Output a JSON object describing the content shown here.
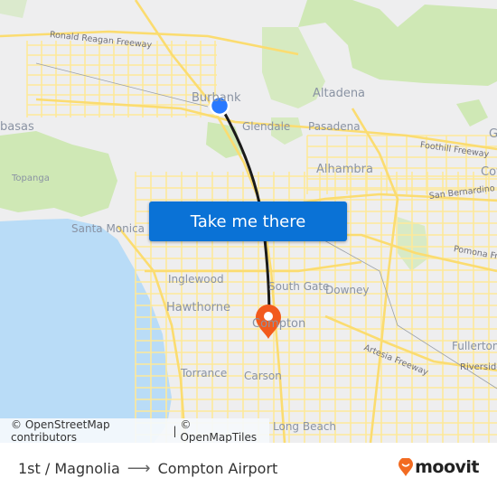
{
  "map": {
    "colors": {
      "land": "#eeeeef",
      "water": "#b9dcf7",
      "park": "#cfe8b5",
      "road": "#fde99a",
      "route": "#1a1a1a",
      "origin": "#2979ff",
      "destination": "#f25a1d"
    },
    "places": [
      {
        "id": "burbank",
        "label": "Burbank"
      },
      {
        "id": "altadena",
        "label": "Altadena"
      },
      {
        "id": "glendale",
        "label": "Glendale"
      },
      {
        "id": "pasadena",
        "label": "Pasadena"
      },
      {
        "id": "calabasas",
        "label": "basas"
      },
      {
        "id": "alhambra",
        "label": "Alhambra"
      },
      {
        "id": "topanga",
        "label": "Topanga"
      },
      {
        "id": "santa-monica",
        "label": "Santa Monica"
      },
      {
        "id": "inglewood",
        "label": "Inglewood"
      },
      {
        "id": "south-gate",
        "label": "South Gate"
      },
      {
        "id": "downey",
        "label": "Downey"
      },
      {
        "id": "hawthorne",
        "label": "Hawthorne"
      },
      {
        "id": "compton",
        "label": "Compton"
      },
      {
        "id": "torrance",
        "label": "Torrance"
      },
      {
        "id": "carson",
        "label": "Carson"
      },
      {
        "id": "long-beach",
        "label": "Long Beach"
      },
      {
        "id": "fullerton",
        "label": "Fullerton"
      },
      {
        "id": "riverside",
        "label": "Riverside"
      },
      {
        "id": "covina",
        "label": "Cov"
      },
      {
        "id": "glendora",
        "label": "G"
      }
    ],
    "roads": [
      {
        "id": "ronald-reagan",
        "label": "Ronald Reagan Freeway"
      },
      {
        "id": "foothill",
        "label": "Foothill Freeway"
      },
      {
        "id": "san-bernardino",
        "label": "San Bernardino F"
      },
      {
        "id": "pomona",
        "label": "Pomona Fr"
      },
      {
        "id": "artesia",
        "label": "Artesia Freeway"
      }
    ],
    "origin_marker": "origin-dot",
    "destination_marker": "map-pin"
  },
  "cta": {
    "label": "Take me there"
  },
  "attribution": {
    "osm": "© OpenStreetMap contributors",
    "separator": "|",
    "omt": "© OpenMapTiles"
  },
  "footer": {
    "origin": "1st / Magnolia",
    "arrow": "⟶",
    "destination": "Compton Airport",
    "brand": "moovit",
    "brand_color": "#f26b21"
  }
}
